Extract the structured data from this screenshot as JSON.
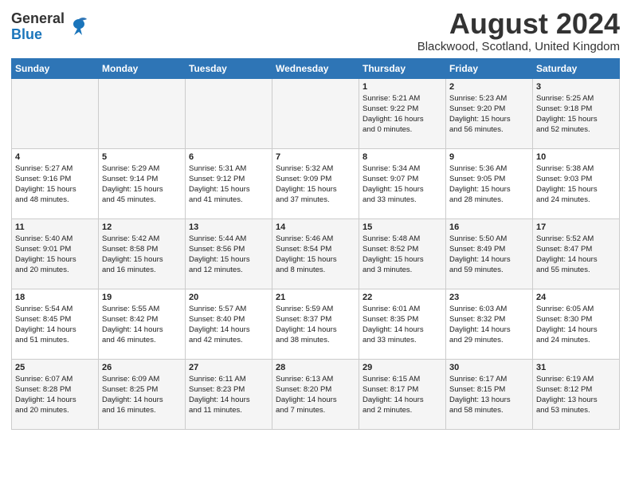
{
  "header": {
    "logo_general": "General",
    "logo_blue": "Blue",
    "month_title": "August 2024",
    "location": "Blackwood, Scotland, United Kingdom"
  },
  "weekdays": [
    "Sunday",
    "Monday",
    "Tuesday",
    "Wednesday",
    "Thursday",
    "Friday",
    "Saturday"
  ],
  "weeks": [
    [
      {
        "day": "",
        "info": ""
      },
      {
        "day": "",
        "info": ""
      },
      {
        "day": "",
        "info": ""
      },
      {
        "day": "",
        "info": ""
      },
      {
        "day": "1",
        "info": "Sunrise: 5:21 AM\nSunset: 9:22 PM\nDaylight: 16 hours\nand 0 minutes."
      },
      {
        "day": "2",
        "info": "Sunrise: 5:23 AM\nSunset: 9:20 PM\nDaylight: 15 hours\nand 56 minutes."
      },
      {
        "day": "3",
        "info": "Sunrise: 5:25 AM\nSunset: 9:18 PM\nDaylight: 15 hours\nand 52 minutes."
      }
    ],
    [
      {
        "day": "4",
        "info": "Sunrise: 5:27 AM\nSunset: 9:16 PM\nDaylight: 15 hours\nand 48 minutes."
      },
      {
        "day": "5",
        "info": "Sunrise: 5:29 AM\nSunset: 9:14 PM\nDaylight: 15 hours\nand 45 minutes."
      },
      {
        "day": "6",
        "info": "Sunrise: 5:31 AM\nSunset: 9:12 PM\nDaylight: 15 hours\nand 41 minutes."
      },
      {
        "day": "7",
        "info": "Sunrise: 5:32 AM\nSunset: 9:09 PM\nDaylight: 15 hours\nand 37 minutes."
      },
      {
        "day": "8",
        "info": "Sunrise: 5:34 AM\nSunset: 9:07 PM\nDaylight: 15 hours\nand 33 minutes."
      },
      {
        "day": "9",
        "info": "Sunrise: 5:36 AM\nSunset: 9:05 PM\nDaylight: 15 hours\nand 28 minutes."
      },
      {
        "day": "10",
        "info": "Sunrise: 5:38 AM\nSunset: 9:03 PM\nDaylight: 15 hours\nand 24 minutes."
      }
    ],
    [
      {
        "day": "11",
        "info": "Sunrise: 5:40 AM\nSunset: 9:01 PM\nDaylight: 15 hours\nand 20 minutes."
      },
      {
        "day": "12",
        "info": "Sunrise: 5:42 AM\nSunset: 8:58 PM\nDaylight: 15 hours\nand 16 minutes."
      },
      {
        "day": "13",
        "info": "Sunrise: 5:44 AM\nSunset: 8:56 PM\nDaylight: 15 hours\nand 12 minutes."
      },
      {
        "day": "14",
        "info": "Sunrise: 5:46 AM\nSunset: 8:54 PM\nDaylight: 15 hours\nand 8 minutes."
      },
      {
        "day": "15",
        "info": "Sunrise: 5:48 AM\nSunset: 8:52 PM\nDaylight: 15 hours\nand 3 minutes."
      },
      {
        "day": "16",
        "info": "Sunrise: 5:50 AM\nSunset: 8:49 PM\nDaylight: 14 hours\nand 59 minutes."
      },
      {
        "day": "17",
        "info": "Sunrise: 5:52 AM\nSunset: 8:47 PM\nDaylight: 14 hours\nand 55 minutes."
      }
    ],
    [
      {
        "day": "18",
        "info": "Sunrise: 5:54 AM\nSunset: 8:45 PM\nDaylight: 14 hours\nand 51 minutes."
      },
      {
        "day": "19",
        "info": "Sunrise: 5:55 AM\nSunset: 8:42 PM\nDaylight: 14 hours\nand 46 minutes."
      },
      {
        "day": "20",
        "info": "Sunrise: 5:57 AM\nSunset: 8:40 PM\nDaylight: 14 hours\nand 42 minutes."
      },
      {
        "day": "21",
        "info": "Sunrise: 5:59 AM\nSunset: 8:37 PM\nDaylight: 14 hours\nand 38 minutes."
      },
      {
        "day": "22",
        "info": "Sunrise: 6:01 AM\nSunset: 8:35 PM\nDaylight: 14 hours\nand 33 minutes."
      },
      {
        "day": "23",
        "info": "Sunrise: 6:03 AM\nSunset: 8:32 PM\nDaylight: 14 hours\nand 29 minutes."
      },
      {
        "day": "24",
        "info": "Sunrise: 6:05 AM\nSunset: 8:30 PM\nDaylight: 14 hours\nand 24 minutes."
      }
    ],
    [
      {
        "day": "25",
        "info": "Sunrise: 6:07 AM\nSunset: 8:28 PM\nDaylight: 14 hours\nand 20 minutes."
      },
      {
        "day": "26",
        "info": "Sunrise: 6:09 AM\nSunset: 8:25 PM\nDaylight: 14 hours\nand 16 minutes."
      },
      {
        "day": "27",
        "info": "Sunrise: 6:11 AM\nSunset: 8:23 PM\nDaylight: 14 hours\nand 11 minutes."
      },
      {
        "day": "28",
        "info": "Sunrise: 6:13 AM\nSunset: 8:20 PM\nDaylight: 14 hours\nand 7 minutes."
      },
      {
        "day": "29",
        "info": "Sunrise: 6:15 AM\nSunset: 8:17 PM\nDaylight: 14 hours\nand 2 minutes."
      },
      {
        "day": "30",
        "info": "Sunrise: 6:17 AM\nSunset: 8:15 PM\nDaylight: 13 hours\nand 58 minutes."
      },
      {
        "day": "31",
        "info": "Sunrise: 6:19 AM\nSunset: 8:12 PM\nDaylight: 13 hours\nand 53 minutes."
      }
    ]
  ]
}
